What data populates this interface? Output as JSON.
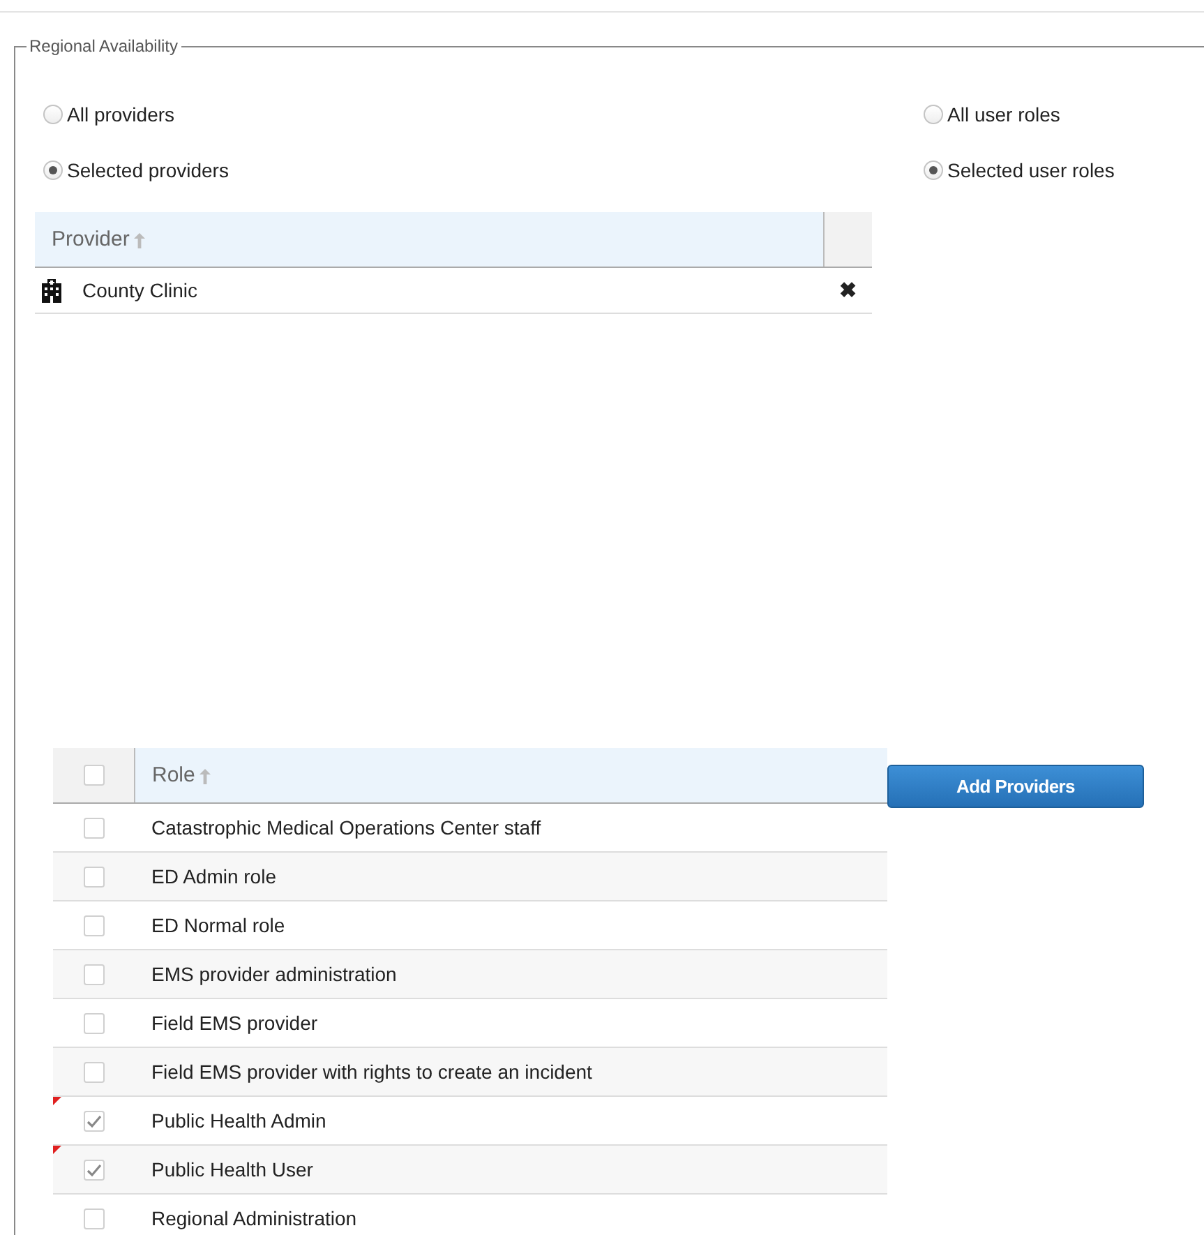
{
  "fieldset": {
    "legend": "Regional Availability"
  },
  "provider_scope": [
    {
      "label": "All providers",
      "selected": false
    },
    {
      "label": "Selected providers",
      "selected": true
    }
  ],
  "role_scope": [
    {
      "label": "All user roles",
      "selected": false
    },
    {
      "label": "Selected user roles",
      "selected": true
    }
  ],
  "providers_table": {
    "columns": [
      "Provider"
    ],
    "rows": [
      {
        "name": "County Clinic",
        "remove": "✖"
      }
    ]
  },
  "roles_table": {
    "select_all_checked": false,
    "columns": [
      "Role"
    ],
    "rows": [
      {
        "name": "Catastrophic Medical Operations Center staff",
        "checked": false,
        "changed": false
      },
      {
        "name": "ED Admin role",
        "checked": false,
        "changed": false
      },
      {
        "name": "ED Normal role",
        "checked": false,
        "changed": false
      },
      {
        "name": "EMS provider administration",
        "checked": false,
        "changed": false
      },
      {
        "name": "Field EMS provider",
        "checked": false,
        "changed": false
      },
      {
        "name": "Field EMS provider with rights to create an incident",
        "checked": false,
        "changed": false
      },
      {
        "name": "Public Health Admin",
        "checked": true,
        "changed": true
      },
      {
        "name": "Public Health User",
        "checked": true,
        "changed": true
      },
      {
        "name": "Regional Administration",
        "checked": false,
        "changed": false
      }
    ]
  },
  "add_button": "Add Providers"
}
